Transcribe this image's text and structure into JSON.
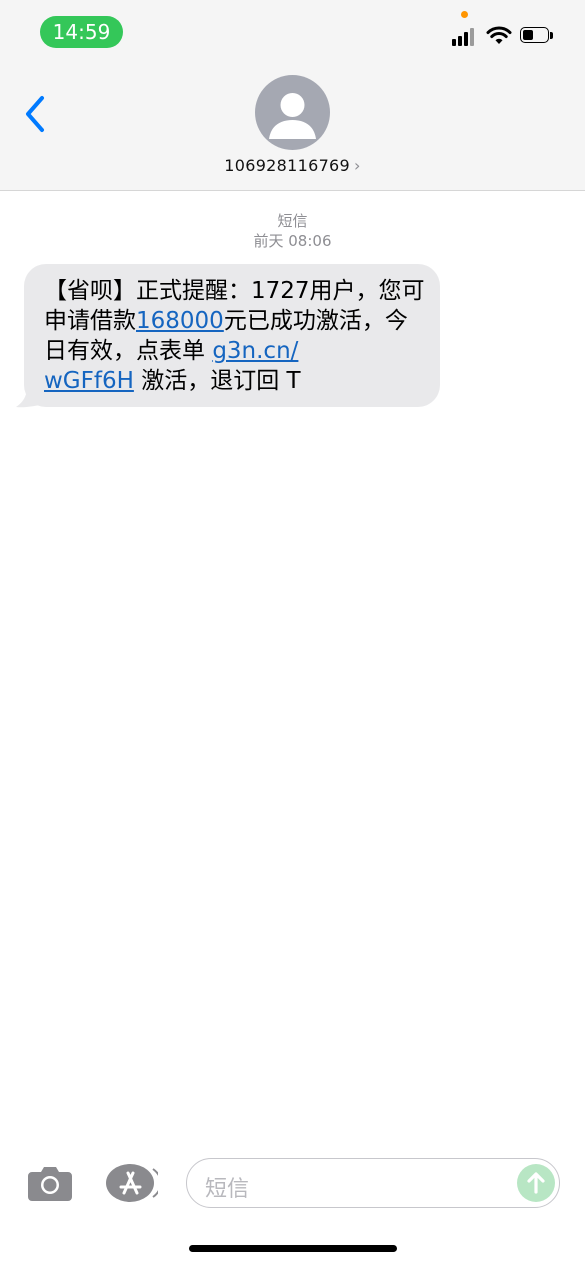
{
  "status_bar": {
    "time": "14:59"
  },
  "header": {
    "contact_number": "106928116769",
    "chevron": "›"
  },
  "conversation": {
    "service_label": "短信",
    "timestamp": "前天 08:06",
    "message": {
      "part1": "【省呗】正式提醒：1727用户，您可申请借款",
      "amount_link": "168000",
      "part2": "元已成功激活，今日有效，点表单 ",
      "url_link_line1": "g3n.cn/",
      "url_link_line2": "wGFf6H",
      "part3": " 激活，退订回 T"
    }
  },
  "input_bar": {
    "placeholder": "短信"
  },
  "colors": {
    "accent_blue": "#1565c0",
    "time_pill_green": "#34c759",
    "bubble_gray": "#e9e9eb"
  },
  "icons": [
    "back-chevron-icon",
    "contact-avatar-icon",
    "camera-icon",
    "app-store-icon",
    "send-arrow-icon",
    "signal-icon",
    "wifi-icon",
    "battery-icon"
  ]
}
